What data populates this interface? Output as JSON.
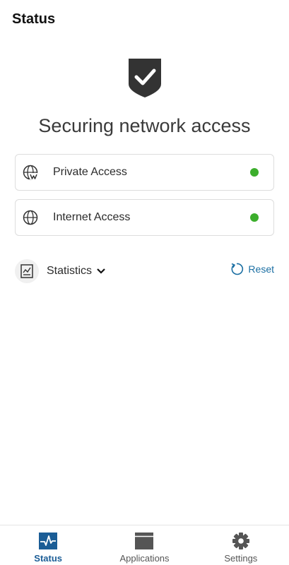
{
  "header": {
    "title": "Status"
  },
  "status": {
    "shield_icon": "shield-check-icon",
    "headline": "Securing network access"
  },
  "access": [
    {
      "label": "Private Access",
      "icon": "globe-network-icon",
      "state_color": "#3cae2c"
    },
    {
      "label": "Internet Access",
      "icon": "globe-icon",
      "state_color": "#3cae2c"
    }
  ],
  "statistics": {
    "label": "Statistics",
    "icon": "report-icon",
    "reset_label": "Reset",
    "reset_icon": "refresh-icon"
  },
  "bottom_nav": {
    "items": [
      {
        "label": "Status",
        "icon": "pulse-icon",
        "active": true
      },
      {
        "label": "Applications",
        "icon": "window-icon",
        "active": false
      },
      {
        "label": "Settings",
        "icon": "gear-icon",
        "active": false
      }
    ]
  },
  "colors": {
    "accent": "#1b6fa3",
    "active_nav": "#1b5d96",
    "status_ok": "#3cae2c"
  }
}
